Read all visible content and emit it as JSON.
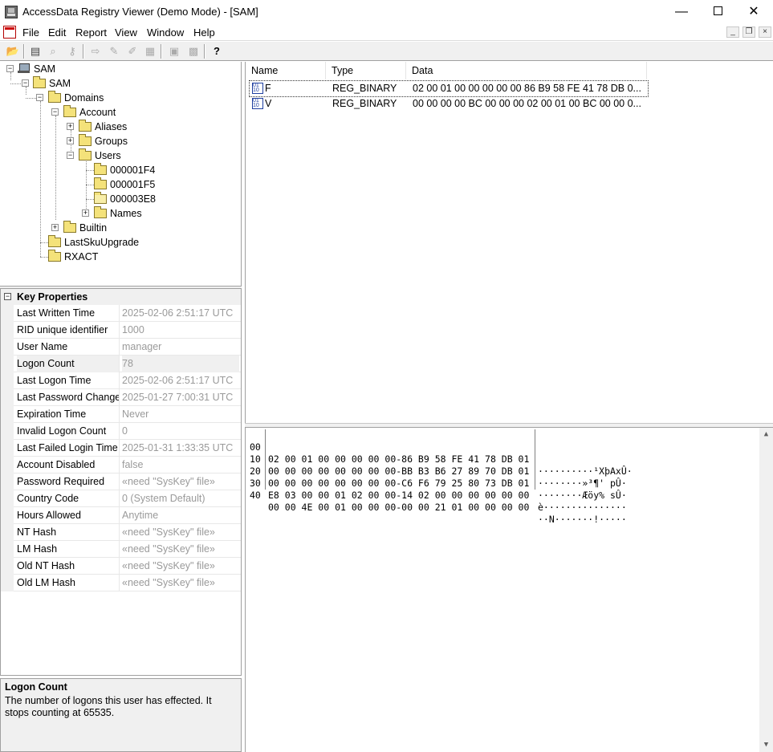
{
  "window": {
    "title": "AccessData Registry Viewer (Demo Mode) - [SAM]",
    "controls": {
      "minimize": "—",
      "close": "✕"
    }
  },
  "menu": {
    "items": [
      "File",
      "Edit",
      "Report",
      "View",
      "Window",
      "Help"
    ],
    "mdi": {
      "minimize": "_",
      "restore": "❐",
      "close": "×"
    }
  },
  "toolbar": {
    "buttons": [
      {
        "icon": "open-folder-icon",
        "glyph": "📂",
        "enabled": true
      },
      {
        "icon": "computer-icon",
        "glyph": "▤",
        "enabled": true
      },
      {
        "icon": "find-icon",
        "glyph": "⌕",
        "enabled": false
      },
      {
        "icon": "key-icon",
        "glyph": "⚷",
        "enabled": false
      },
      {
        "icon": "export-icon",
        "glyph": "⇨",
        "enabled": false
      },
      {
        "icon": "edit-icon",
        "glyph": "✎",
        "enabled": false
      },
      {
        "icon": "edit-value-icon",
        "glyph": "✐",
        "enabled": false
      },
      {
        "icon": "clipboard-icon",
        "glyph": "▦",
        "enabled": false
      },
      {
        "icon": "report-add-icon",
        "glyph": "▣",
        "enabled": false
      },
      {
        "icon": "report-icon",
        "glyph": "▩",
        "enabled": false
      },
      {
        "icon": "help-icon",
        "glyph": "?",
        "enabled": true
      }
    ]
  },
  "tree": {
    "nodes": [
      {
        "label": "SAM",
        "level": 0,
        "icon": "computer-icon",
        "expander": "−"
      },
      {
        "label": "SAM",
        "level": 1,
        "icon": "folder-icon",
        "expander": "−"
      },
      {
        "label": "Domains",
        "level": 2,
        "icon": "folder-icon",
        "expander": "−"
      },
      {
        "label": "Account",
        "level": 3,
        "icon": "folder-icon",
        "expander": "−"
      },
      {
        "label": "Aliases",
        "level": 4,
        "icon": "folder-icon",
        "expander": "+"
      },
      {
        "label": "Groups",
        "level": 4,
        "icon": "folder-icon",
        "expander": "+"
      },
      {
        "label": "Users",
        "level": 4,
        "icon": "folder-icon",
        "expander": "−"
      },
      {
        "label": "000001F4",
        "level": 5,
        "icon": "folder-icon",
        "expander": ""
      },
      {
        "label": "000001F5",
        "level": 5,
        "icon": "folder-icon",
        "expander": ""
      },
      {
        "label": "000003E8",
        "level": 5,
        "icon": "open-folder-icon",
        "expander": ""
      },
      {
        "label": "Names",
        "level": 5,
        "icon": "folder-icon",
        "expander": "+"
      },
      {
        "label": "Builtin",
        "level": 3,
        "icon": "folder-icon",
        "expander": "+"
      },
      {
        "label": "LastSkuUpgrade",
        "level": 2,
        "icon": "folder-icon",
        "expander": ""
      },
      {
        "label": "RXACT",
        "level": 2,
        "icon": "folder-icon",
        "expander": ""
      }
    ]
  },
  "properties": {
    "header": "Key Properties",
    "toggle": "−",
    "rows": [
      {
        "name": "Last Written Time",
        "value": "2025-02-06 2:51:17 UTC"
      },
      {
        "name": "RID unique identifier",
        "value": "1000"
      },
      {
        "name": "User Name",
        "value": "manager"
      },
      {
        "name": "Logon Count",
        "value": "78",
        "selected": true
      },
      {
        "name": "Last Logon Time",
        "value": "2025-02-06 2:51:17 UTC"
      },
      {
        "name": "Last Password Change Time",
        "value": "2025-01-27 7:00:31 UTC"
      },
      {
        "name": "Expiration Time",
        "value": "Never"
      },
      {
        "name": "Invalid Logon Count",
        "value": "0"
      },
      {
        "name": "Last Failed Login Time",
        "value": "2025-01-31 1:33:35 UTC"
      },
      {
        "name": "Account Disabled",
        "value": "false"
      },
      {
        "name": "Password Required",
        "value": "«need \"SysKey\" file»"
      },
      {
        "name": "Country Code",
        "value": "0 (System Default)"
      },
      {
        "name": "Hours Allowed",
        "value": "Anytime"
      },
      {
        "name": "NT Hash",
        "value": "«need \"SysKey\" file»"
      },
      {
        "name": "LM Hash",
        "value": "«need \"SysKey\" file»"
      },
      {
        "name": "Old NT Hash",
        "value": "«need \"SysKey\" file»"
      },
      {
        "name": "Old LM Hash",
        "value": "«need \"SysKey\" file»"
      }
    ]
  },
  "description": {
    "title": "Logon Count",
    "body": "The number of logons this user has effected.  It stops counting at 65535."
  },
  "values_list": {
    "columns": [
      "Name",
      "Type",
      "Data"
    ],
    "rows": [
      {
        "name": "F",
        "type": "REG_BINARY",
        "data": "02 00 01 00 00 00 00 00 86 B9 58 FE 41 78 DB 0..."
      },
      {
        "name": "V",
        "type": "REG_BINARY",
        "data": "00 00 00 00 BC 00 00 00 02 00 01 00 BC 00 00 0..."
      }
    ]
  },
  "hex_view": {
    "rows": [
      {
        "offset": "00",
        "bytes": "02 00 01 00 00 00 00 00-86 B9 58 FE 41 78 DB 01",
        "ascii": "··········¹XþAxÛ·"
      },
      {
        "offset": "10",
        "bytes": "00 00 00 00 00 00 00 00-BB B3 B6 27 89 70 DB 01",
        "ascii": "········»³¶' pÛ·"
      },
      {
        "offset": "20",
        "bytes": "00 00 00 00 00 00 00 00-C6 F6 79 25 80 73 DB 01",
        "ascii": "········Æöy% sÛ·"
      },
      {
        "offset": "30",
        "bytes": "E8 03 00 00 01 02 00 00-14 02 00 00 00 00 00 00",
        "ascii": "è···············"
      },
      {
        "offset": "40",
        "bytes": "00 00 4E 00 01 00 00 00-00 00 21 01 00 00 00 00",
        "ascii": "··N·······!·····"
      }
    ]
  },
  "scrollbar": {
    "up": "▲",
    "down": "▼"
  }
}
